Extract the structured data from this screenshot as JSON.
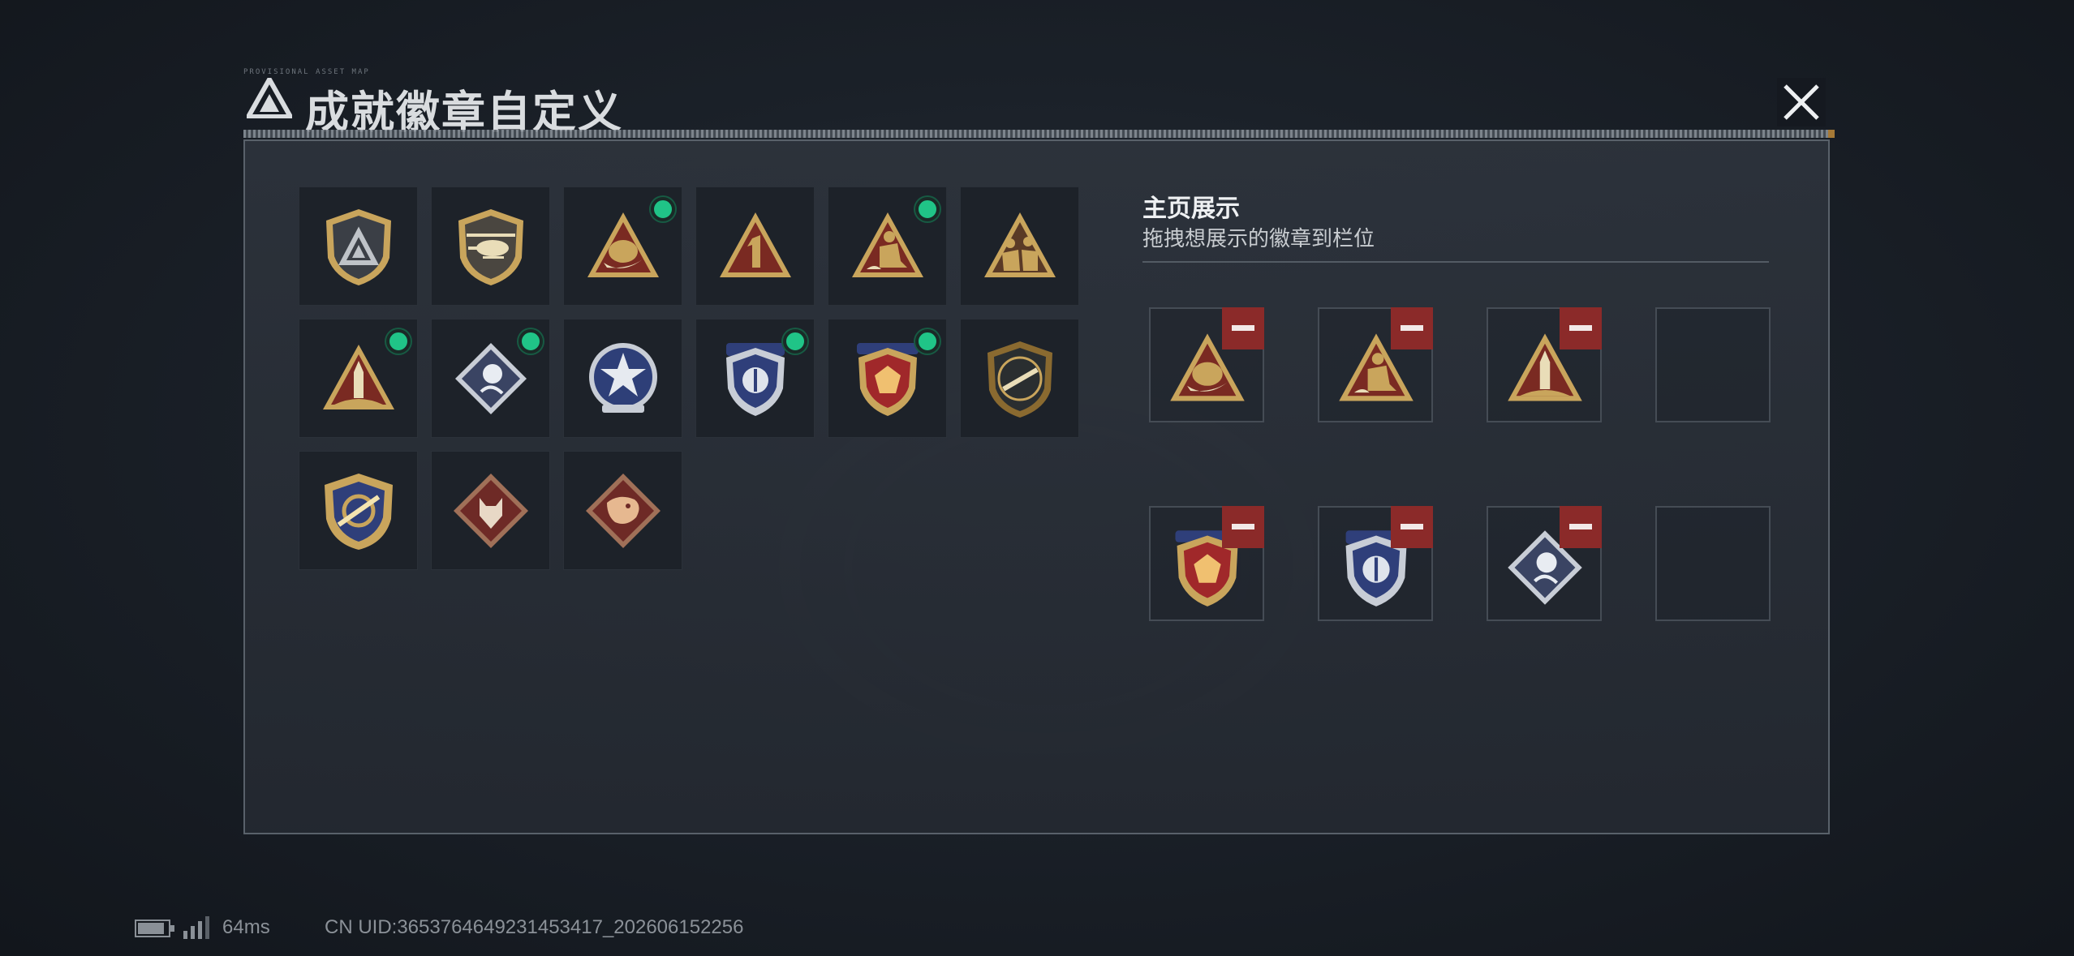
{
  "header": {
    "title": "成就徽章自定义",
    "tiny_text": "PROVISIONAL ASSET MAP",
    "logo_icon": "delta-triangle-logo-icon",
    "close_icon": "close-icon"
  },
  "collection": {
    "badges": [
      {
        "icon": "shield-delta-badge-icon",
        "new": false
      },
      {
        "icon": "helicopter-shield-badge-icon",
        "new": false
      },
      {
        "icon": "egg-nest-triangle-badge-icon",
        "new": true
      },
      {
        "icon": "number-one-triangle-badge-icon",
        "new": false,
        "numeral": "1"
      },
      {
        "icon": "soldier-kneel-triangle-badge-icon",
        "new": true
      },
      {
        "icon": "squad-triangle-badge-icon",
        "new": false
      },
      {
        "icon": "rocket-triangle-badge-icon",
        "new": true
      },
      {
        "icon": "rose-diamond-badge-icon",
        "new": true
      },
      {
        "icon": "star-wing-badge-icon",
        "new": false
      },
      {
        "icon": "blue-eagle-shield-badge-icon",
        "new": true
      },
      {
        "icon": "red-gem-shield-badge-icon",
        "new": true
      },
      {
        "icon": "rifle-shield-badge-icon",
        "new": false
      },
      {
        "icon": "gold-target-shield-badge-icon",
        "new": false
      },
      {
        "icon": "wolf-diamond-badge-icon",
        "new": false
      },
      {
        "icon": "dragon-diamond-badge-icon",
        "new": false
      }
    ]
  },
  "display": {
    "title": "主页展示",
    "subtitle": "拖拽想展示的徽章到栏位",
    "slots": [
      {
        "icon": "egg-nest-triangle-badge-icon",
        "filled": true
      },
      {
        "icon": "soldier-kneel-triangle-badge-icon",
        "filled": true
      },
      {
        "icon": "rocket-triangle-badge-icon",
        "filled": true
      },
      {
        "icon": "",
        "filled": false
      },
      {
        "icon": "red-gem-shield-badge-icon",
        "filled": true
      },
      {
        "icon": "blue-eagle-shield-badge-icon",
        "filled": true
      },
      {
        "icon": "rose-diamond-badge-icon",
        "filled": true
      },
      {
        "icon": "",
        "filled": false
      }
    ],
    "remove_icon": "minus-icon"
  },
  "status": {
    "ping": "64ms",
    "uid": "CN UID:3653764649231453417_202606152256",
    "battery_icon": "battery-icon",
    "signal_icon": "signal-icon"
  },
  "colors": {
    "panel_bg": "#2b313a",
    "new_dot": "#20c487",
    "remove_button": "#8b2a29",
    "gold": "#c9a55c"
  }
}
